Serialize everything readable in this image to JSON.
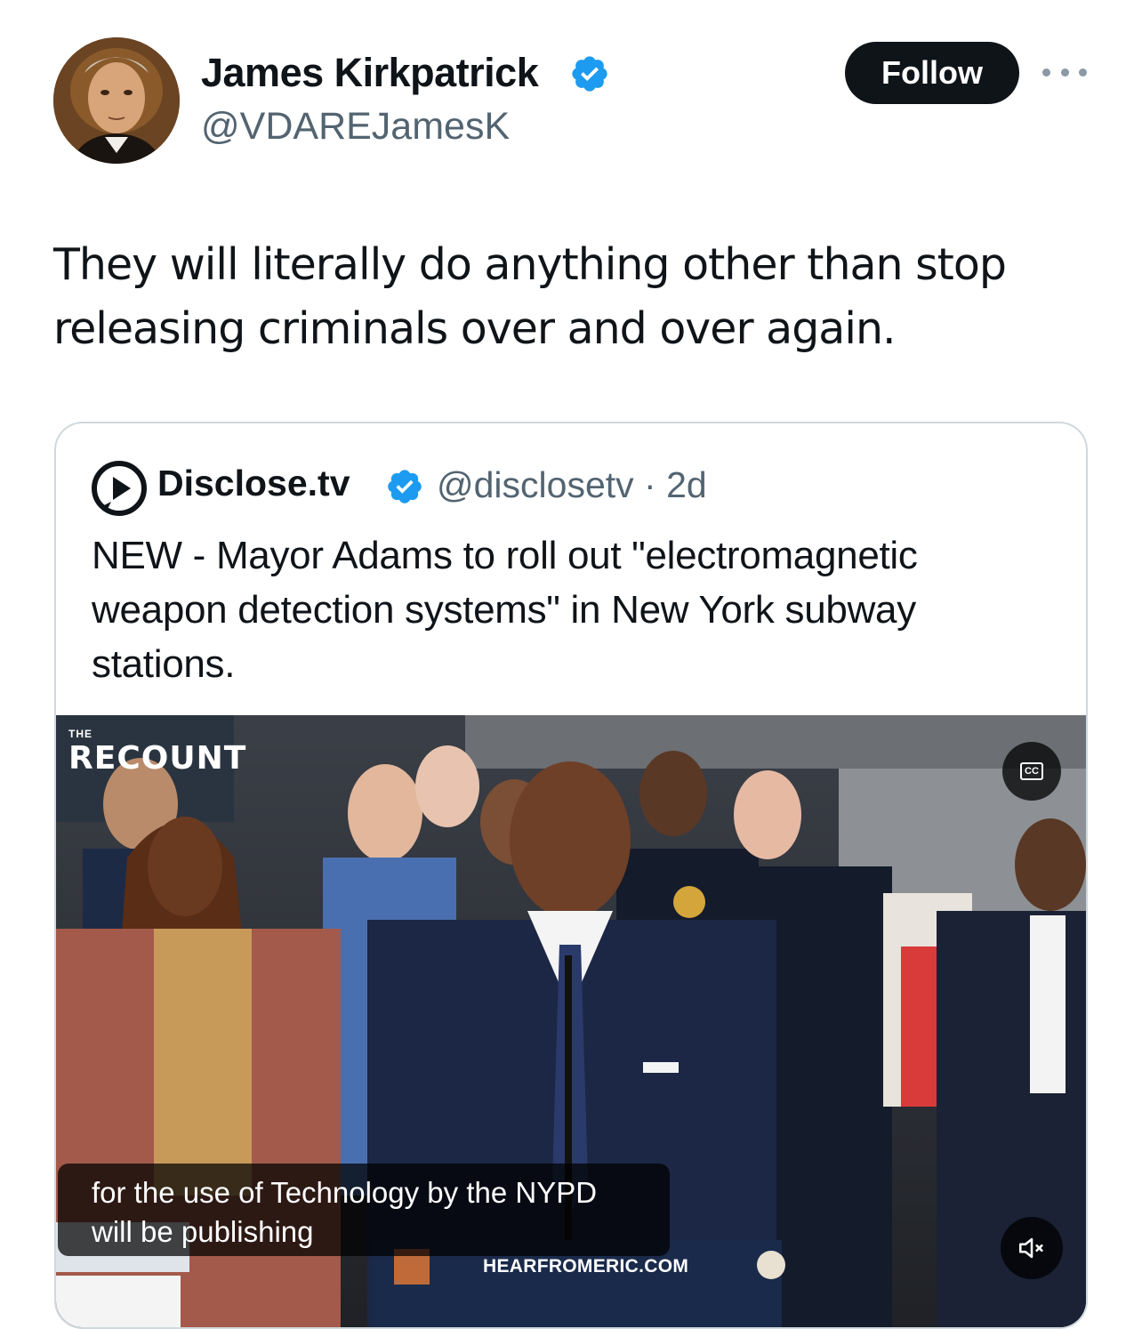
{
  "tweet": {
    "author": {
      "name": "James Kirkpatrick",
      "handle": "@VDAREJamesK",
      "verified": true
    },
    "follow_label": "Follow",
    "text": "They will literally do anything other than stop releasing criminals over and over again."
  },
  "quoted": {
    "author": {
      "name": "Disclose.tv",
      "handle": "@disclosetv",
      "verified": true
    },
    "meta": "· 2d",
    "text": "NEW - Mayor Adams to roll out \"electromagnetic weapon detection systems\" in New York subway stations.",
    "video": {
      "watermark_small": "THE",
      "watermark": "RECOUNT",
      "caption_line1": "for the use of Technology by the NYPD",
      "caption_line2": "will be publishing",
      "podium_text": "HEARFROMERIC.COM",
      "cc_label": "CC",
      "mute_icon": "speaker-muted-icon"
    }
  },
  "colors": {
    "verified": "#1d9bf0",
    "follow_bg": "#0f1419",
    "secondary_text": "#536471",
    "border": "#cfd9de"
  }
}
